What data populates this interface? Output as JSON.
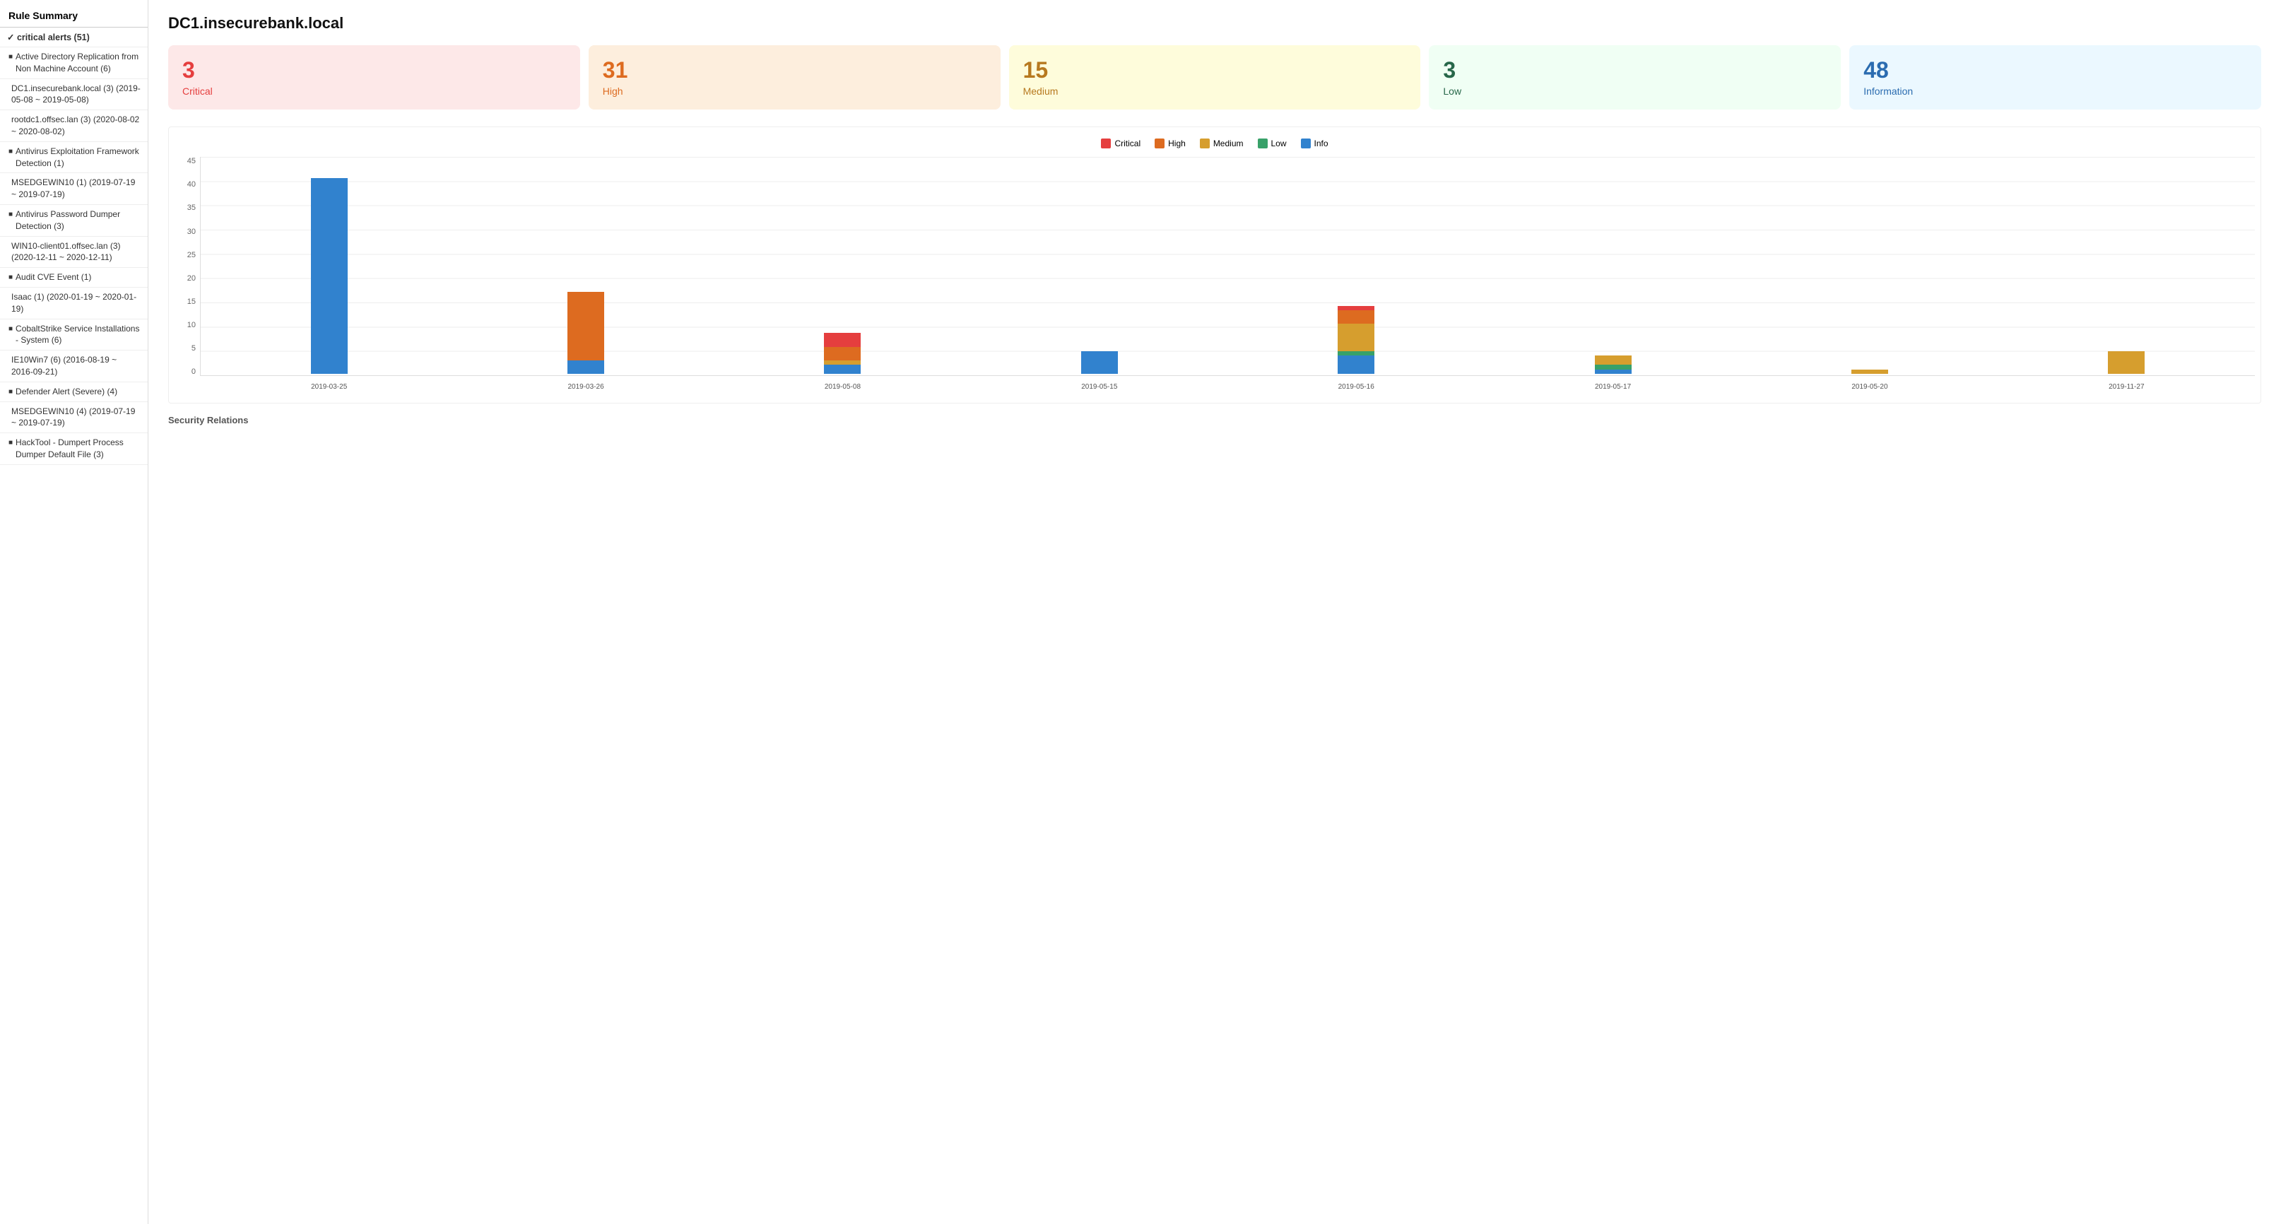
{
  "sidebar": {
    "title": "Rule Summary",
    "group": {
      "label": "✓ critical alerts (51)"
    },
    "items": [
      {
        "type": "rule",
        "text": "Active Directory Replication from Non Machine Account (6)"
      },
      {
        "type": "host",
        "text": "DC1.insecurebank.local (3) (2019-05-08 ~ 2019-05-08)"
      },
      {
        "type": "host",
        "text": "rootdc1.offsec.lan (3) (2020-08-02 ~ 2020-08-02)"
      },
      {
        "type": "rule",
        "text": "Antivirus Exploitation Framework Detection (1)"
      },
      {
        "type": "host",
        "text": "MSEDGEWIN10 (1) (2019-07-19 ~ 2019-07-19)"
      },
      {
        "type": "rule",
        "text": "Antivirus Password Dumper Detection (3)"
      },
      {
        "type": "host",
        "text": "WIN10-client01.offsec.lan (3) (2020-12-11 ~ 2020-12-11)"
      },
      {
        "type": "rule",
        "text": "Audit CVE Event (1)"
      },
      {
        "type": "host",
        "text": "Isaac (1) (2020-01-19 ~ 2020-01-19)"
      },
      {
        "type": "rule",
        "text": "CobaltStrike Service Installations - System (6)"
      },
      {
        "type": "host",
        "text": "IE10Win7 (6) (2016-08-19 ~ 2016-09-21)"
      },
      {
        "type": "rule",
        "text": "Defender Alert (Severe) (4)"
      },
      {
        "type": "host",
        "text": "MSEDGEWIN10 (4) (2019-07-19 ~ 2019-07-19)"
      },
      {
        "type": "rule",
        "text": "HackTool - Dumpert Process Dumper Default File (3)"
      }
    ]
  },
  "main": {
    "title": "DC1.insecurebank.local",
    "stats": [
      {
        "id": "critical",
        "number": "3",
        "label": "Critical",
        "card_class": "card-critical"
      },
      {
        "id": "high",
        "number": "31",
        "label": "High",
        "card_class": "card-high"
      },
      {
        "id": "medium",
        "number": "15",
        "label": "Medium",
        "card_class": "card-medium"
      },
      {
        "id": "low",
        "number": "3",
        "label": "Low",
        "card_class": "card-low"
      },
      {
        "id": "info",
        "number": "48",
        "label": "Information",
        "card_class": "card-info"
      }
    ],
    "chart": {
      "legend": [
        {
          "label": "Critical",
          "color": "#e53e3e"
        },
        {
          "label": "High",
          "color": "#dd6b20"
        },
        {
          "label": "Medium",
          "color": "#d69e2e"
        },
        {
          "label": "Low",
          "color": "#38a169"
        },
        {
          "label": "Info",
          "color": "#3182ce"
        }
      ],
      "y_labels": [
        "0",
        "5",
        "10",
        "15",
        "20",
        "25",
        "30",
        "35",
        "40",
        "45"
      ],
      "max_value": 45,
      "bars": [
        {
          "date": "2019-03-25",
          "critical": 0,
          "high": 0,
          "medium": 0,
          "low": 0,
          "info": 43
        },
        {
          "date": "2019-03-26",
          "critical": 0,
          "high": 15,
          "medium": 0,
          "low": 0,
          "info": 3
        },
        {
          "date": "2019-05-08",
          "critical": 3,
          "high": 3,
          "medium": 1,
          "low": 0,
          "info": 2
        },
        {
          "date": "2019-05-15",
          "critical": 0,
          "high": 0,
          "medium": 0,
          "low": 0,
          "info": 5
        },
        {
          "date": "2019-05-16",
          "critical": 1,
          "high": 3,
          "medium": 6,
          "low": 1,
          "info": 4
        },
        {
          "date": "2019-05-17",
          "critical": 0,
          "high": 0,
          "medium": 2,
          "low": 1,
          "info": 1
        },
        {
          "date": "2019-05-20",
          "critical": 0,
          "high": 0,
          "medium": 1,
          "low": 0,
          "info": 0
        },
        {
          "date": "2019-11-27",
          "critical": 0,
          "high": 0,
          "medium": 5,
          "low": 0,
          "info": 0
        }
      ]
    },
    "section_subtitle": "Security Relations"
  }
}
